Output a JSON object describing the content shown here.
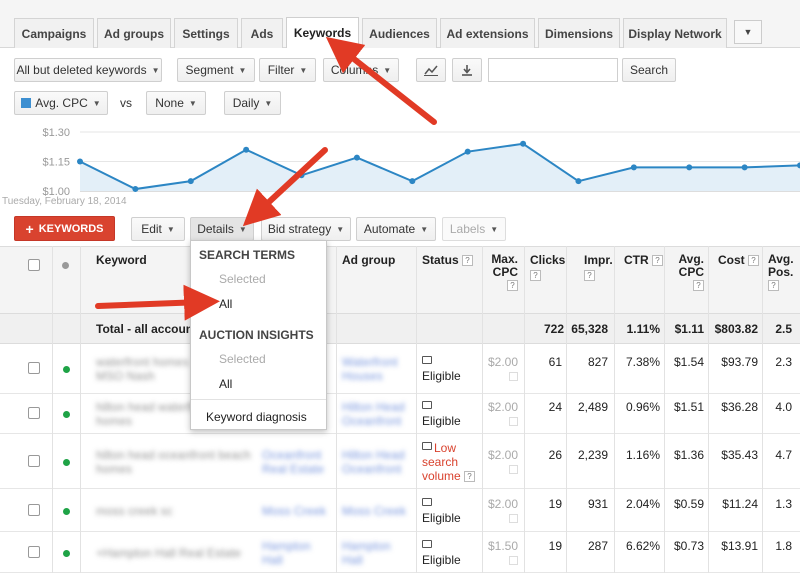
{
  "tabs": [
    {
      "label": "Campaigns",
      "active": false
    },
    {
      "label": "Ad groups",
      "active": false
    },
    {
      "label": "Settings",
      "active": false
    },
    {
      "label": "Ads",
      "active": false
    },
    {
      "label": "Keywords",
      "active": true
    },
    {
      "label": "Audiences",
      "active": false
    },
    {
      "label": "Ad extensions",
      "active": false
    },
    {
      "label": "Dimensions",
      "active": false
    },
    {
      "label": "Display Network",
      "active": false
    }
  ],
  "toolbar": {
    "filter_select": "All but deleted keywords",
    "segment": "Segment",
    "filter": "Filter",
    "columns": "Columns",
    "search_placeholder": "",
    "search_button": "Search"
  },
  "chart_controls": {
    "metric1": "Avg. CPC",
    "vs": "vs",
    "metric2": "None",
    "granularity": "Daily",
    "metric_color": "#3d8fd1"
  },
  "chart_data": {
    "type": "area",
    "ytick_labels": [
      "$1.30",
      "$1.15",
      "$1.00"
    ],
    "ylim": [
      1.0,
      1.3
    ],
    "start_date_label": "Tuesday, February 18, 2014",
    "series": [
      {
        "values": [
          1.15,
          1.01,
          1.05,
          1.21,
          1.08,
          1.17,
          1.05,
          1.2,
          1.24,
          1.05,
          1.12,
          1.12,
          1.12,
          1.13
        ]
      }
    ]
  },
  "action_bar": {
    "add_button": "KEYWORDS",
    "edit": "Edit",
    "details": "Details",
    "bid_strategy": "Bid strategy",
    "automate": "Automate",
    "labels": "Labels"
  },
  "details_menu": {
    "section1": "SEARCH TERMS",
    "section1_items": [
      "Selected",
      "All"
    ],
    "section2": "AUCTION INSIGHTS",
    "section2_items": [
      "Selected",
      "All"
    ],
    "extra_item": "Keyword diagnosis"
  },
  "table": {
    "headers": {
      "keyword": "Keyword",
      "ad_group": "Ad group",
      "status": "Status",
      "max_cpc": "Max. CPC",
      "clicks": "Clicks",
      "impr": "Impr.",
      "ctr": "CTR",
      "avg_cpc": "Avg. CPC",
      "cost": "Cost",
      "avg_pos": "Avg. Pos."
    },
    "total": {
      "label": "Total - all accoun",
      "clicks": "722",
      "impr": "65,328",
      "ctr": "1.11%",
      "avg_cpc": "$1.11",
      "cost": "$803.82",
      "avg_pos": "2.5"
    },
    "rows": [
      {
        "keyword": "waterfront homes",
        "keyword2": "MSO Nash",
        "campaign": "",
        "ad_group": "Waterfront",
        "ad_group2": "Houses",
        "status": "Eligible",
        "max_cpc": "$2.00",
        "clicks": "61",
        "impr": "827",
        "ctr": "7.38%",
        "avg_cpc": "$1.54",
        "cost": "$93.79",
        "avg_pos": "2.3"
      },
      {
        "keyword": "hilton head waterfront",
        "keyword2": "homes",
        "campaign": "",
        "ad_group": "Hilton Head",
        "ad_group2": "Oceanfront",
        "status": "Eligible",
        "max_cpc": "$2.00",
        "clicks": "24",
        "impr": "2,489",
        "ctr": "0.96%",
        "avg_cpc": "$1.51",
        "cost": "$36.28",
        "avg_pos": "4.0"
      },
      {
        "keyword": "hilton head oceanfront beach",
        "keyword2": "homes",
        "campaign": "Oceanfront",
        "campaign2": "Real Estate",
        "ad_group": "Hilton Head",
        "ad_group2": "Oceanfront",
        "status": "Low search volume",
        "status_low": true,
        "max_cpc": "$2.00",
        "clicks": "26",
        "impr": "2,239",
        "ctr": "1.16%",
        "avg_cpc": "$1.36",
        "cost": "$35.43",
        "avg_pos": "4.7"
      },
      {
        "keyword": "moss creek sc",
        "keyword2": "",
        "campaign": "Moss Creek",
        "ad_group": "Moss Creek",
        "ad_group2": "",
        "status": "Eligible",
        "max_cpc": "$2.00",
        "clicks": "19",
        "impr": "931",
        "ctr": "2.04%",
        "avg_cpc": "$0.59",
        "cost": "$11.24",
        "avg_pos": "1.3"
      },
      {
        "keyword": "+Hampton Hall Real Estate",
        "keyword2": "",
        "campaign": "Hampton",
        "campaign2": "Hall",
        "ad_group": "Hampton",
        "ad_group2": "Hall",
        "status": "Eligible",
        "max_cpc": "$1.50",
        "clicks": "19",
        "impr": "287",
        "ctr": "6.62%",
        "avg_cpc": "$0.73",
        "cost": "$13.91",
        "avg_pos": "1.8"
      }
    ]
  }
}
